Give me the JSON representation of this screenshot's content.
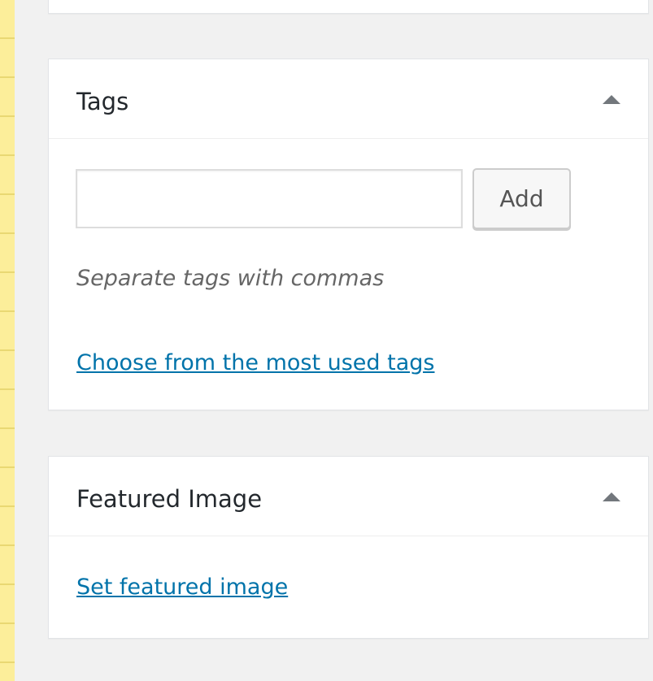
{
  "tags_box": {
    "title": "Tags",
    "input_value": "",
    "add_label": "Add",
    "howto": "Separate tags with commas",
    "choose_link": "Choose from the most used tags"
  },
  "featured_box": {
    "title": "Featured Image",
    "set_link": "Set featured image"
  },
  "icons": {
    "toggle": "arrow-up-icon"
  },
  "colors": {
    "link": "#0073aa",
    "admin_bg": "#f1f1f1",
    "notepad": "#fcee9a"
  }
}
